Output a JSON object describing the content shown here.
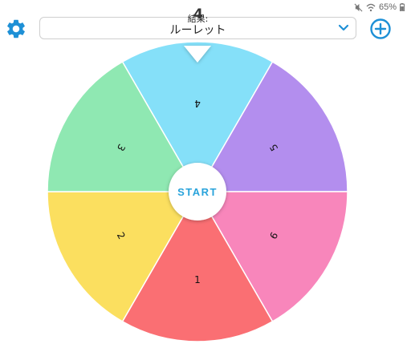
{
  "status": {
    "battery": "65%"
  },
  "header": {
    "label": "結果:",
    "selected": "ルーレット",
    "result": "4"
  },
  "wheel": {
    "start_label": "START",
    "segments": [
      {
        "label": "4",
        "color": "#85E0F9"
      },
      {
        "label": "5",
        "color": "#B38EEE"
      },
      {
        "label": "6",
        "color": "#F886BB"
      },
      {
        "label": "1",
        "color": "#FA6F73"
      },
      {
        "label": "2",
        "color": "#FBDF5F"
      },
      {
        "label": "3",
        "color": "#8FE8B2"
      }
    ],
    "start_color": "#29A3DB"
  },
  "icons": {
    "settings": "gear-icon",
    "add": "plus-circle-icon",
    "dropdown": "chevron-down-icon"
  }
}
